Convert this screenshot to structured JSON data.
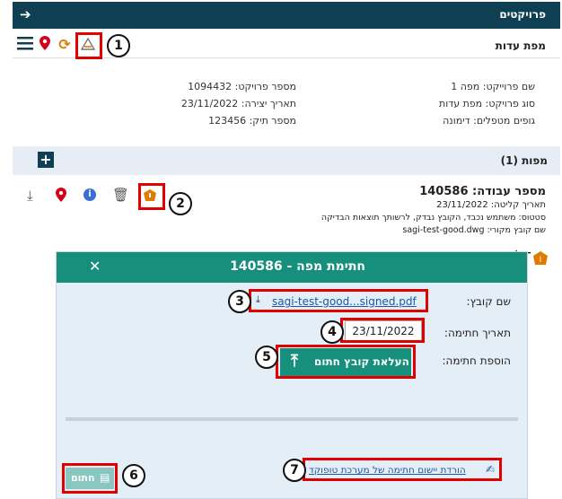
{
  "topbar": {
    "title": "פרויקטים",
    "back_icon": "arrow-right"
  },
  "map_section": {
    "title": "מפת עדות"
  },
  "toolbar_icons": [
    "map-icon",
    "refresh-icon",
    "location-icon",
    "menu-icon"
  ],
  "project": {
    "name": "שם פרוייקט: מפה 1",
    "type": "סוג פרויקט: מפת עדות",
    "bodies": "גופים מטפלים: דימונה",
    "number": "מספר פרויקט: 1094432",
    "created": "תאריך יצירה: 23/11/2022",
    "file_number": "מספר תיק: 123456"
  },
  "maps_section": {
    "title": "מפות (1)"
  },
  "work": {
    "title": "מספר עבודה: 140586",
    "received": "תאריך קליטה: 23/11/2022",
    "status": "סטטוס: משתמש נכבד, הקובץ נבדק, לרשותך תוצאות הבדיקה",
    "source": "שם קובץ מקורי: sagi-test-good.dwg"
  },
  "modal": {
    "title": "חתימת מפה - 140586",
    "file_label": "שם קובץ:",
    "file_link": "sagi-test-good...signed.pdf",
    "date_label": "תאריך חתימה:",
    "date_value": "23/11/2022",
    "add_label": "הוספת חתימה:",
    "upload_button": "העלאת קובץ חתום",
    "sign_button": "חתום",
    "download_link": "הורדת יישום חתימה של מערכת טופוקד"
  },
  "callouts": {
    "c1": "1",
    "c2": "2",
    "c3": "3",
    "c4": "4",
    "c5": "5",
    "c6": "6",
    "c7": "7",
    "cI": "I"
  },
  "colors": {
    "topbar": "#0f3f52",
    "modal_header": "#16907c",
    "callout": "#e00000",
    "orange": "#e07a00"
  }
}
